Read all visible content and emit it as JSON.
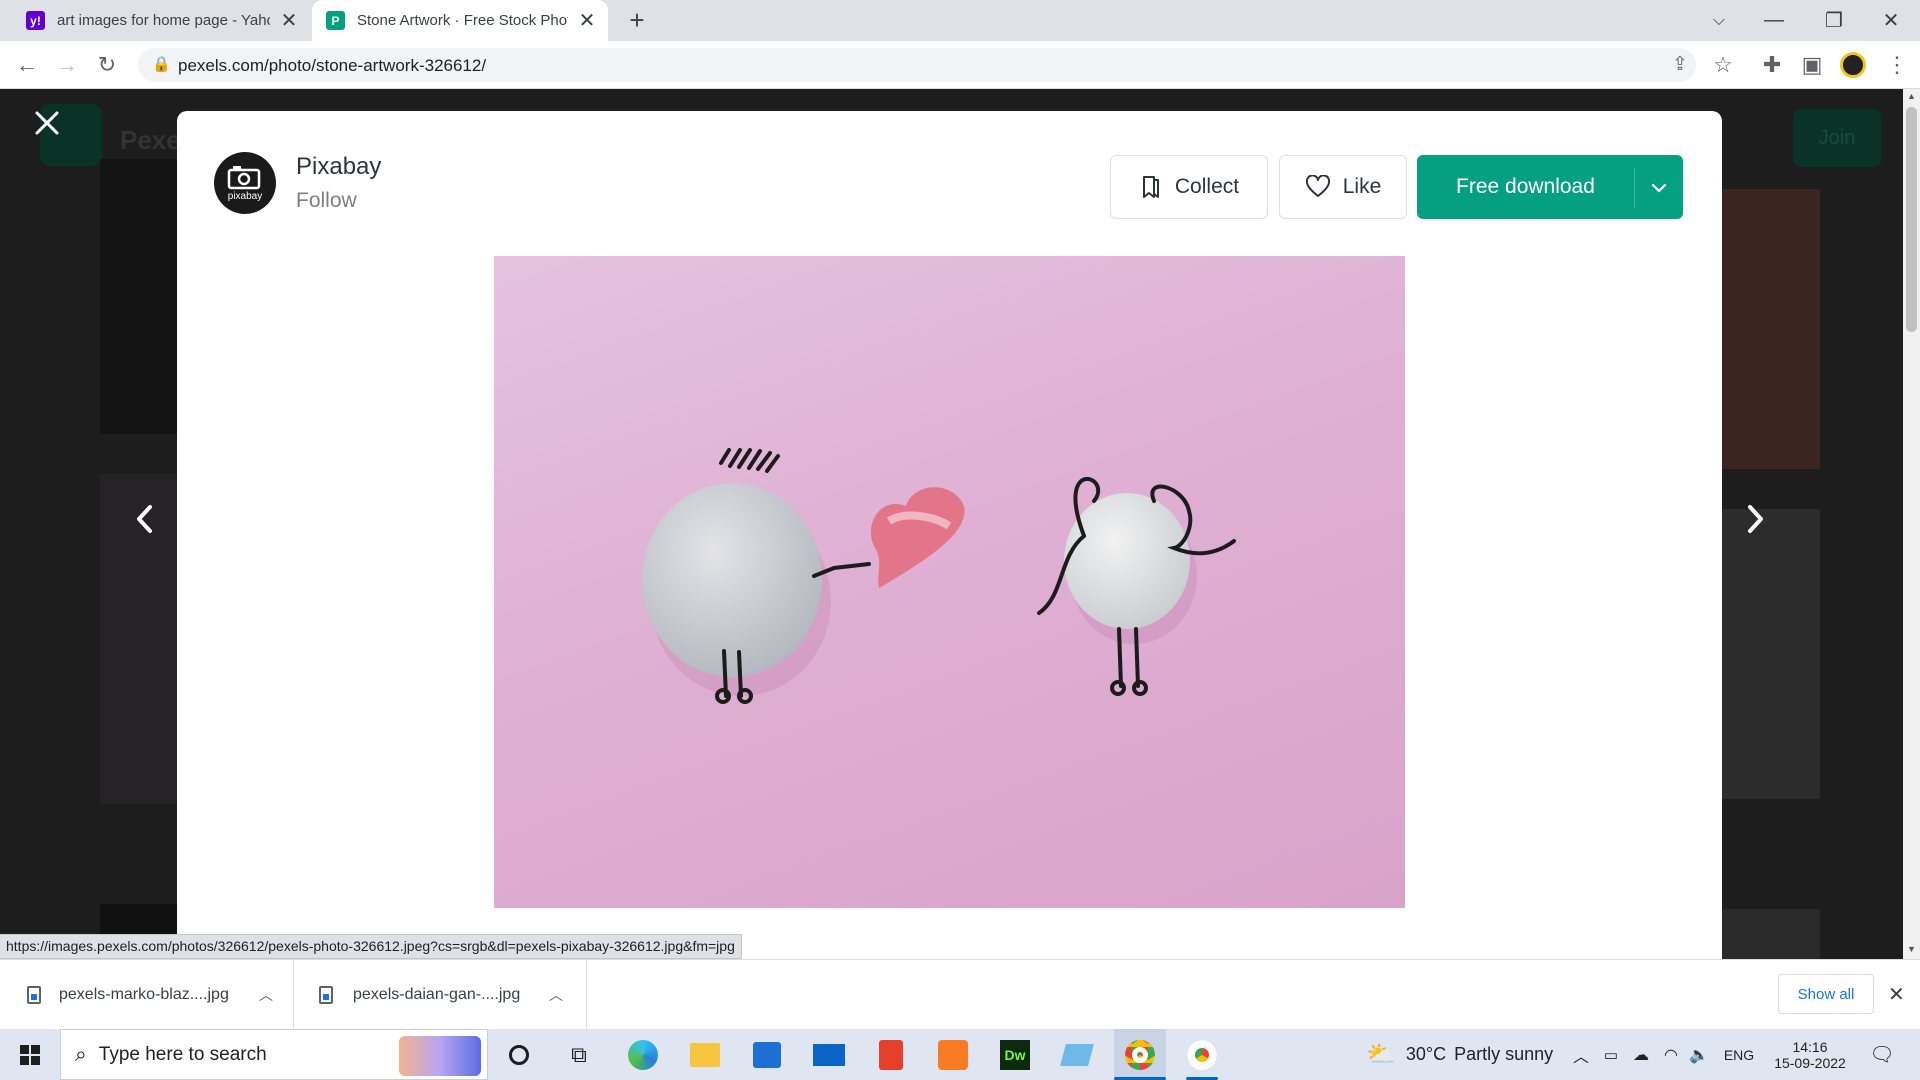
{
  "browser": {
    "tabs": [
      {
        "title": "art images for home page - Yahoo",
        "favicon": "yahoo-icon",
        "active": false
      },
      {
        "title": "Stone Artwork · Free Stock Photo",
        "favicon": "pexels-icon",
        "active": true
      }
    ],
    "new_tab": "+",
    "url": "pexels.com/photo/stone-artwork-326612/",
    "status_url": "https://images.pexels.com/photos/326612/pexels-photo-326612.jpeg?cs=srgb&dl=pexels-pixabay-326612.jpg&fm=jpg"
  },
  "background_page": {
    "logo_text": "Pexe",
    "join_label": "Join"
  },
  "modal": {
    "author_name": "Pixabay",
    "author_logo_text": "pixabay",
    "follow_label": "Follow",
    "collect_label": "Collect",
    "like_label": "Like",
    "download_label": "Free download",
    "accent_color": "#05a081"
  },
  "downloads": {
    "items": [
      "pexels-marko-blaz....jpg",
      "pexels-daian-gan-....jpg"
    ],
    "show_all": "Show all"
  },
  "taskbar": {
    "search_placeholder": "Type here to search",
    "weather_temp": "30°C",
    "weather_desc": "Partly sunny",
    "language": "ENG",
    "time": "14:16",
    "date": "15-09-2022"
  }
}
